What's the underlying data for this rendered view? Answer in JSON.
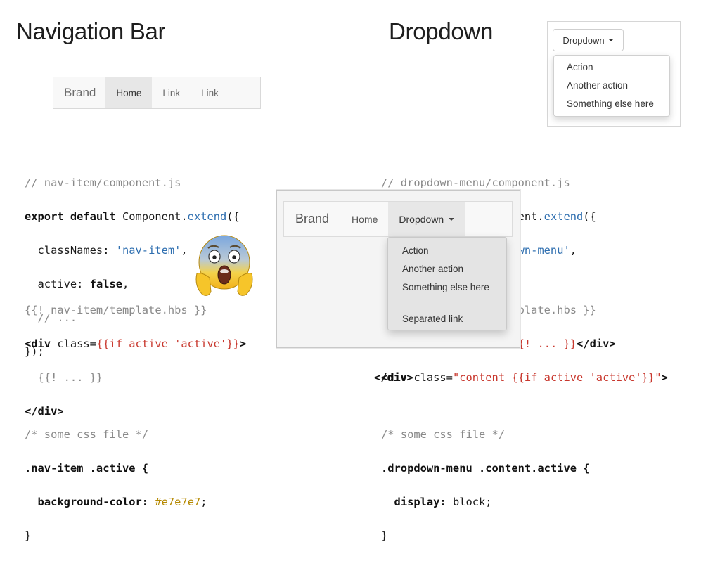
{
  "headings": {
    "left": "Navigation Bar",
    "right": "Dropdown"
  },
  "navbar_demo": {
    "brand": "Brand",
    "items": [
      {
        "label": "Home",
        "active": true
      },
      {
        "label": "Link",
        "active": false
      },
      {
        "label": "Link",
        "active": false
      }
    ]
  },
  "dropdown_demo": {
    "button_label": "Dropdown",
    "menu_items": [
      "Action",
      "Another action",
      "Something else here"
    ]
  },
  "code_left_js": [
    "// nav-item/component.js",
    "export default Component.extend({",
    "  classNames: 'nav-item',",
    "  active: false,",
    "  // ...",
    "});"
  ],
  "code_left_hbs": [
    "{{! nav-item/template.hbs }}",
    "<div class={{if active 'active'}}>",
    "  {{! ... }}",
    "</div>"
  ],
  "code_left_css": [
    "/* some css file */",
    ".nav-item .active {",
    "  background-color: #e7e7e7;",
    "}"
  ],
  "code_right_js": [
    "// dropdown-menu/component.js",
    "export default Component.extend({",
    "  classNames: 'dropdown-menu',"
  ],
  "code_right_hbs": [
    "{{! dropdown-menu/template.hbs }}",
    "<div class=\"toggle\">{{! ... }}</div>",
    "<div class=\"content {{if active 'active'}}\">",
    "</div>"
  ],
  "code_right_css": [
    "/* some css file */",
    ".dropdown-menu .content.active {",
    "  display: block;",
    "}"
  ],
  "overlay": {
    "brand": "Brand",
    "home": "Home",
    "dropdown": "Dropdown",
    "menu_items": [
      "Action",
      "Another action",
      "Something else here",
      "Separated link"
    ]
  },
  "emoji": {
    "icon": "face-screaming-in-fear-icon"
  },
  "colors": {
    "active_bg": "#e7e7e7",
    "code_keyword_blue": "#2f6fb0",
    "code_red": "#c8372d",
    "code_gold": "#b58900"
  }
}
